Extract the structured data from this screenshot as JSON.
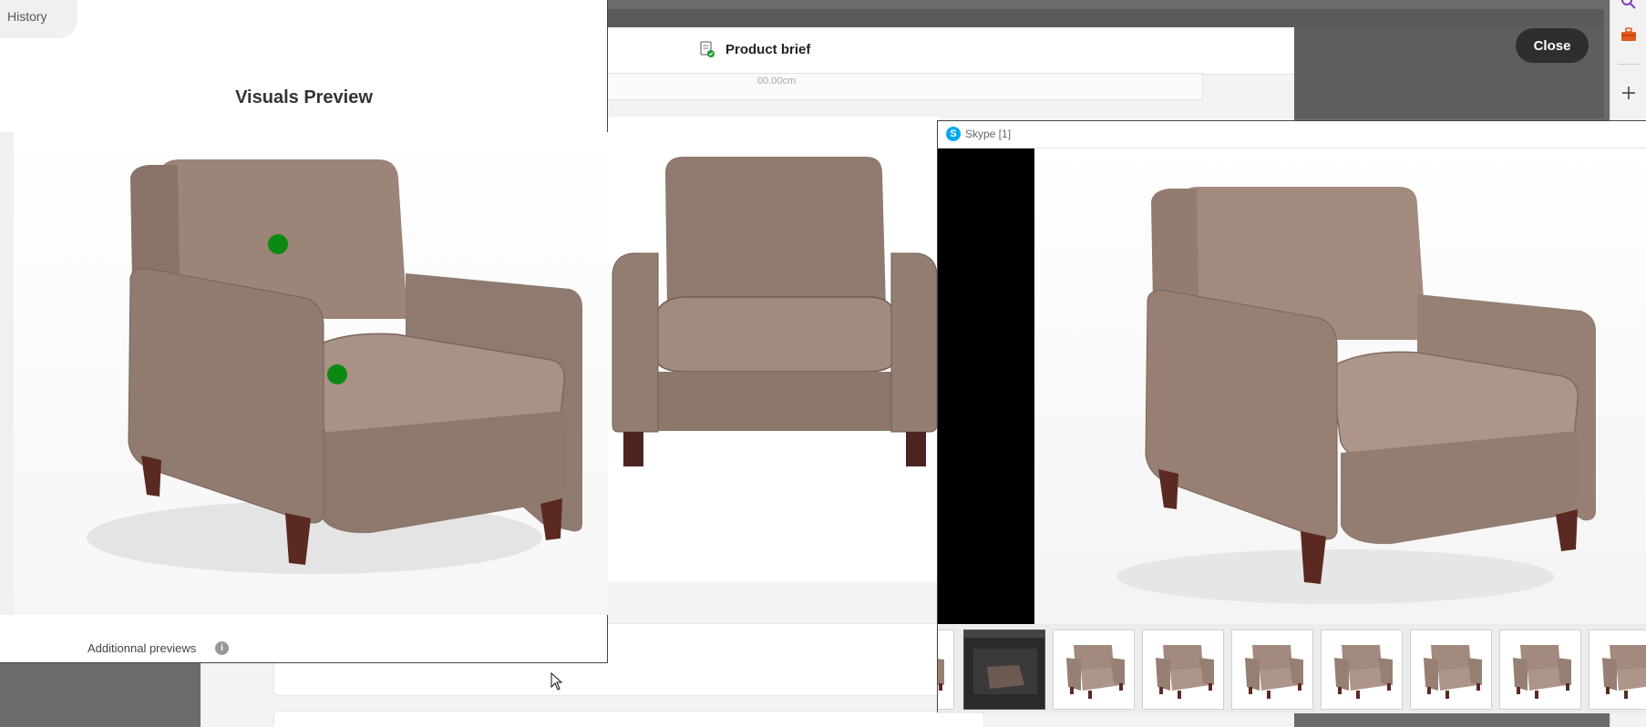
{
  "background_app": {
    "product_brief_label": "Product brief",
    "subcard_text": "00.00cm",
    "close_label": "Close"
  },
  "right_toolbar": {
    "icons": [
      "search-icon",
      "toolbox-icon",
      "plus-icon"
    ]
  },
  "visuals_window": {
    "history_label": "History",
    "title": "Visuals Preview",
    "hotspots": 2,
    "additional_previews_label": "Additionnal previews"
  },
  "skype_window": {
    "title": "Skype [1]",
    "thumbnail_count": 9
  },
  "colors": {
    "chair_leather": "#9b8478",
    "chair_leg": "#5a2a22",
    "hotspot": "#0a8a12",
    "close_button": "#2e2e2e",
    "skype_blue": "#00a9f0"
  }
}
